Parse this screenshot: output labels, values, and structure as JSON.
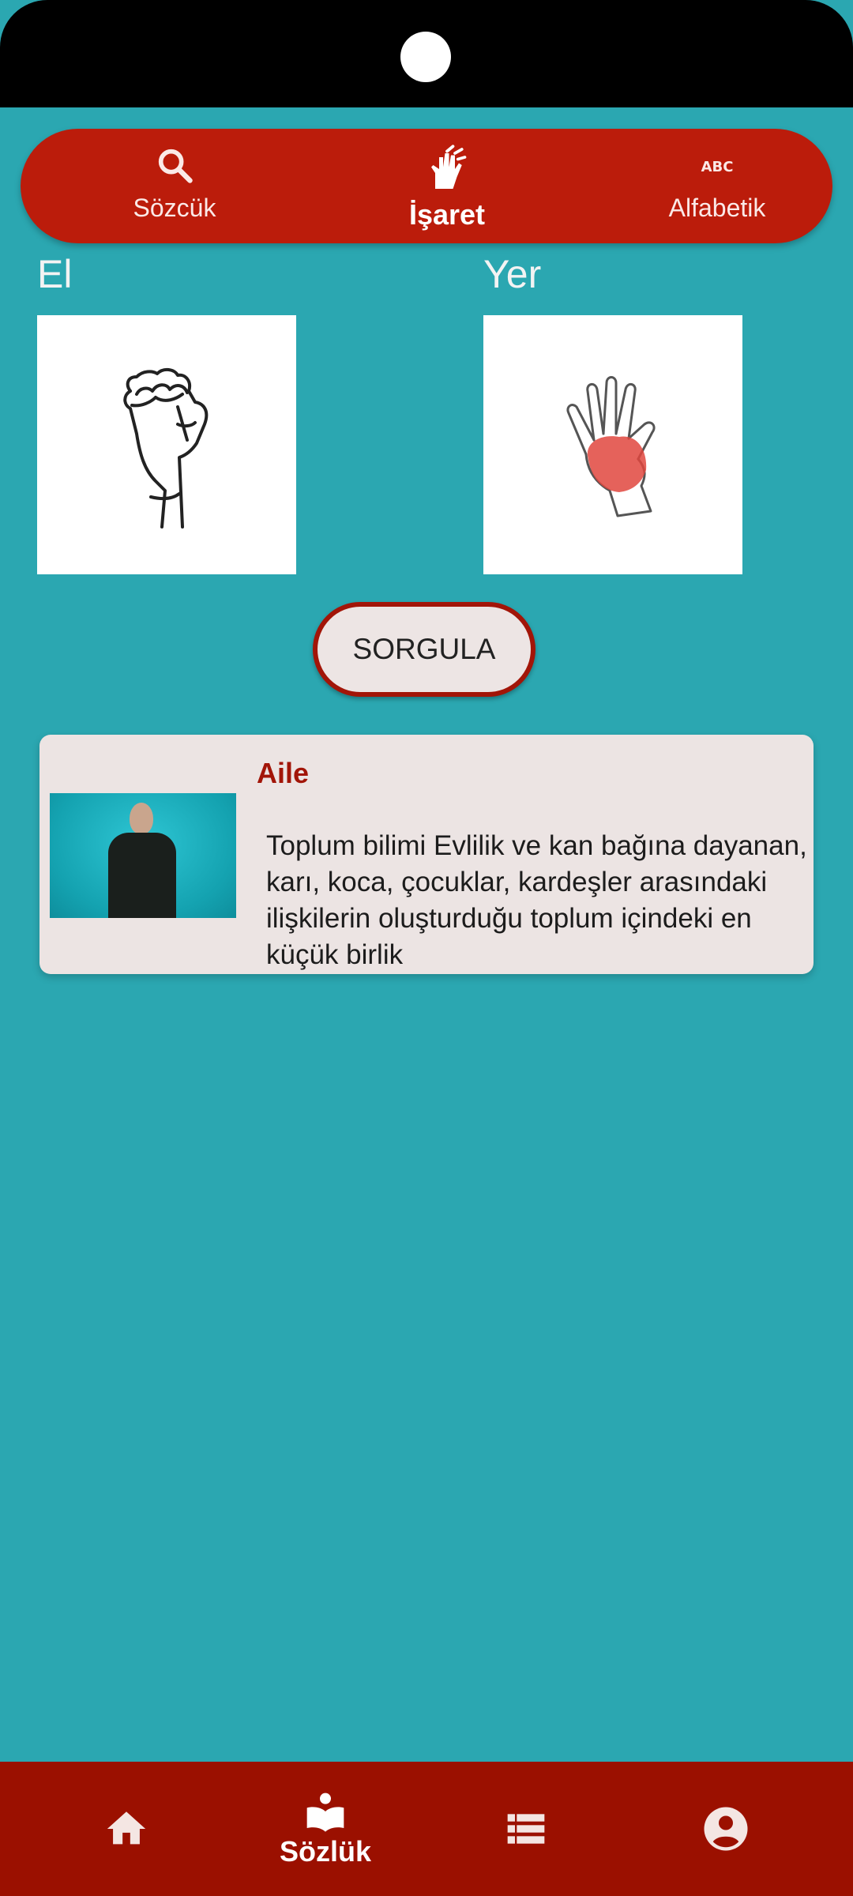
{
  "top_tabs": [
    {
      "label": "Sözcük",
      "icon": "search-icon",
      "active": false
    },
    {
      "label": "İşaret",
      "icon": "sign-language-icon",
      "active": true
    },
    {
      "label": "Alfabetik",
      "icon": "abc-icon",
      "active": false
    }
  ],
  "hand_section": {
    "label": "El"
  },
  "place_section": {
    "label": "Yer"
  },
  "query_button": {
    "label": "SORGULA"
  },
  "result": {
    "title": "Aile",
    "description": "Toplum bilimi Evlilik ve kan bağına dayanan, karı, koca, çocuklar, kardeşler arasındaki ilişkilerin oluşturduğu toplum içindeki en küçük birlik"
  },
  "bottom_nav": [
    {
      "icon": "home-icon",
      "label": ""
    },
    {
      "icon": "dictionary-icon",
      "label": "Sözlük",
      "active": true
    },
    {
      "icon": "list-icon",
      "label": ""
    },
    {
      "icon": "account-icon",
      "label": ""
    }
  ],
  "colors": {
    "background": "#2ba7b1",
    "primary_red": "#bb1c0b",
    "nav_red": "#9b1000",
    "card": "#ece4e3"
  }
}
